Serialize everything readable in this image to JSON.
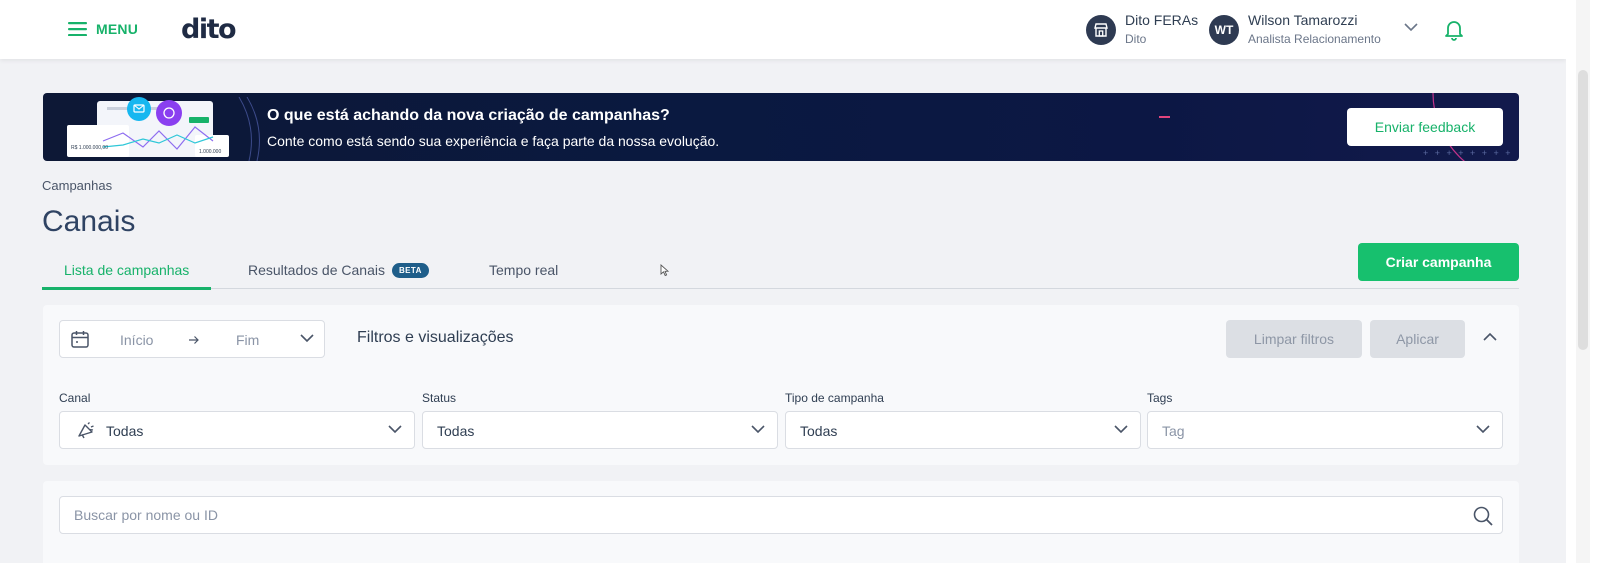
{
  "topbar": {
    "menu_label": "MENU",
    "logo_text": "dito",
    "store": {
      "name": "Dito FERAs",
      "sub": "Dito"
    },
    "user": {
      "initials": "WT",
      "name": "Wilson Tamarozzi",
      "role": "Analista Relacionamento"
    }
  },
  "banner": {
    "title": "O que está achando da nova criação de campanhas?",
    "subtitle": "Conte como está sendo sua experiência e faça parte da nossa evolução.",
    "button_label": "Enviar feedback",
    "art_text_1": "R$ 1.000.000,00",
    "art_text_2": "1.000.000"
  },
  "breadcrumb": "Campanhas",
  "page_title": "Canais",
  "tabs": [
    {
      "label": "Lista de campanhas",
      "active": true
    },
    {
      "label": "Resultados de Canais",
      "badge": "BETA"
    },
    {
      "label": "Tempo real"
    }
  ],
  "create_button": "Criar campanha",
  "filters": {
    "date_start_placeholder": "Início",
    "date_end_placeholder": "Fim",
    "title": "Filtros e visualizações",
    "clear_label": "Limpar filtros",
    "apply_label": "Aplicar",
    "fields": [
      {
        "label": "Canal",
        "value": "Todas"
      },
      {
        "label": "Status",
        "value": "Todas"
      },
      {
        "label": "Tipo de campanha",
        "value": "Todas"
      },
      {
        "label": "Tags",
        "placeholder": "Tag"
      }
    ]
  },
  "search": {
    "placeholder": "Buscar por nome ou ID"
  },
  "colors": {
    "accent": "#17b26a",
    "primary_button": "#17c06e",
    "banner_bg": "#0b1840",
    "title": "#2f4363",
    "badge": "#1f5e8a"
  }
}
